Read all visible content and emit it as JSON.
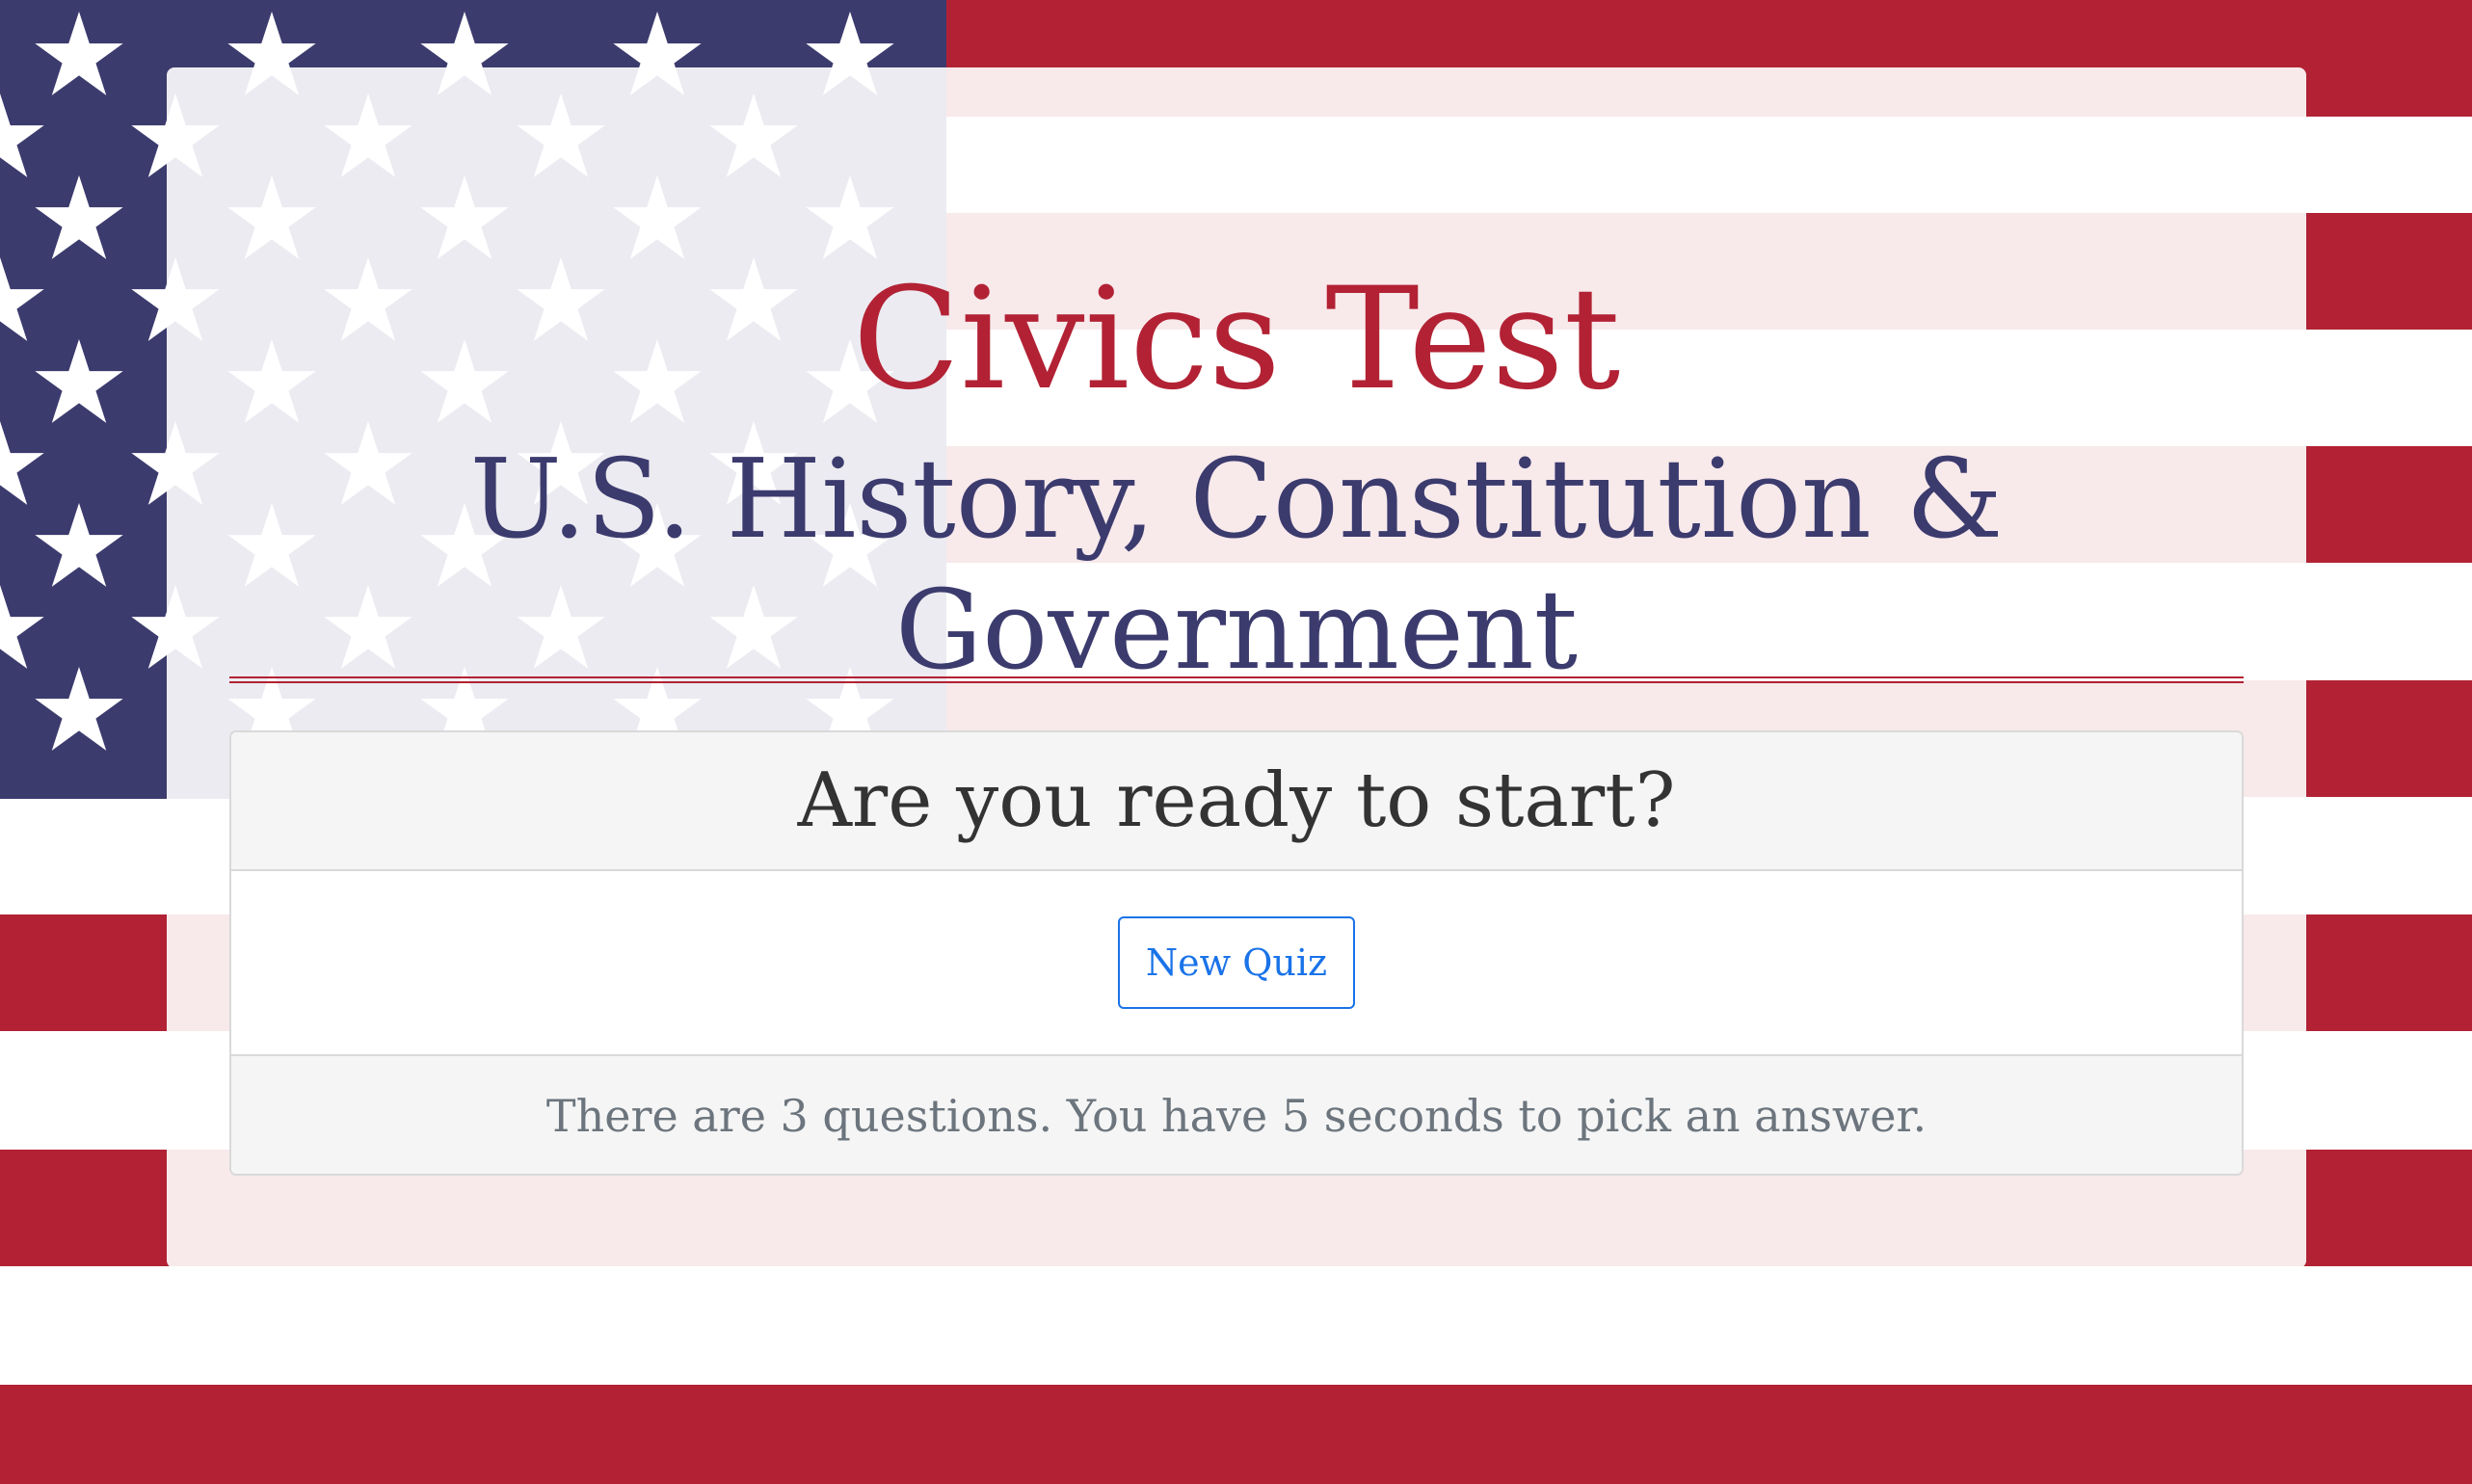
{
  "header": {
    "title": "Civics Test",
    "subtitle": "U.S. History, Constitution & Government"
  },
  "card": {
    "heading": "Are you ready to start?",
    "button_label": "New Quiz",
    "footer_text": "There are 3 questions. You have 5 seconds to pick an answer."
  },
  "colors": {
    "flag_red": "#b22234",
    "flag_blue": "#3c3b6e",
    "button_blue": "#1a73e8",
    "footer_text": "#6c757d"
  },
  "background": {
    "image": "american-flag"
  }
}
